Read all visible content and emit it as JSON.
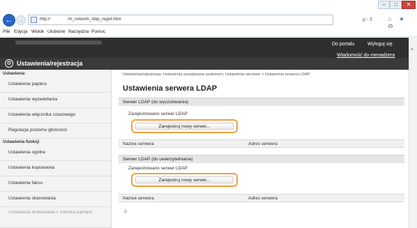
{
  "browser": {
    "url_text": "http://               /m_network_ldap_regist.html",
    "url_tools": "ρ - ĉ",
    "menu": [
      "Plik",
      "Edycja",
      "Widok",
      "Ulubione",
      "Narzędzia",
      "Pomoc"
    ],
    "toolbar_icons": "⌂ ★ ⚙",
    "back_glyph": "←",
    "forward_glyph": "→",
    "close_glyph": "✕",
    "min_glyph": "–",
    "max_glyph": "□"
  },
  "header": {
    "portal_link": "Do portalu",
    "logout_link": "Wyloguj się",
    "message_link": "Wiadomość do menadżera systemu",
    "app_title": "Ustawienia/rejestracja",
    "gear_glyph": "⚙"
  },
  "sidebar": {
    "group1_title": "Ustawienia",
    "group1_items": [
      "Ustawienia papieru",
      "Ustawienia wyświetlania",
      "Ustawienia włącznika czasowego",
      "Regulacja poziomu głośności"
    ],
    "group2_title": "Ustawienia funkcji",
    "group2_items": [
      "Ustawienia ogólne",
      "Ustawienia kopiowania",
      "Ustawienia faksu",
      "Ustawienia skanowania",
      "Ustawienia drukowania z nośnika pamięci"
    ]
  },
  "main": {
    "breadcrumb": "Ustawienia/rejestracja: Ustawienia zarządzania systemem: Ustawienia sieciowe > Ustawienia serwera LDAP",
    "title": "Ustawienia serwera LDAP",
    "section1": {
      "header": "Serwer LDAP (do wyszukiwania)",
      "registered_label": "Zarejestrowano serwer LDAP",
      "button": "Zarejestruj nowy serwer...",
      "col_name": "Nazwa serwera",
      "col_address": "Adres serwera"
    },
    "section2": {
      "header": "Serwer LDAP (do uwierzytelniania)",
      "registered_label": "Zarejestrowano serwer LDAP",
      "button": "Zarejestruj nowy serwer...",
      "col_name": "Nazwa serwera",
      "col_address": "Adres serwera"
    },
    "top_glyph": "≥"
  },
  "colors": {
    "header_bg": "#2f2f2f",
    "button_highlight": "#f0a13c",
    "section_bg": "#e6e6e6",
    "sidebar_bg": "#f3f3f3"
  }
}
